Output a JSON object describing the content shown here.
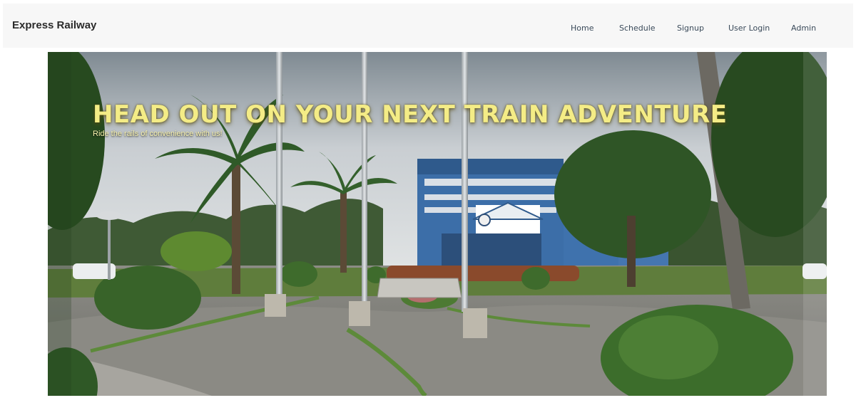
{
  "navbar": {
    "brand": "Express Railway",
    "links": [
      {
        "label": "Home"
      },
      {
        "label": "Schedule"
      },
      {
        "label": "Signup"
      },
      {
        "label": "User Login"
      },
      {
        "label": "Admin"
      }
    ]
  },
  "hero": {
    "title": "HEAD OUT ON YOUR NEXT TRAIN ADVENTURE",
    "subtitle": "Ride the rails of convenience with us!"
  },
  "colors": {
    "navbar_bg": "#f7f7f7",
    "title_color": "#f4ec86",
    "building_blue": "#3c6ea8"
  }
}
